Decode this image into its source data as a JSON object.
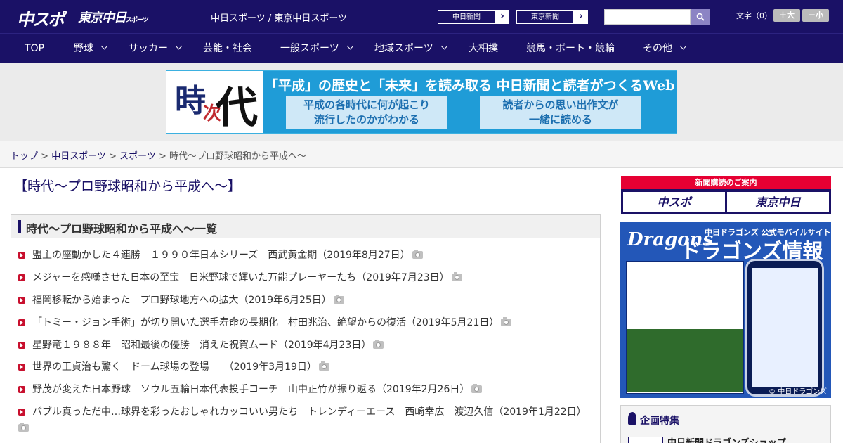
{
  "header": {
    "logo_chuspo": "中スポ",
    "logo_tokyo": "東京中日",
    "logo_tokyo_sub": "スポーツ",
    "site_title": "中日スポーツ / 東京中日スポーツ",
    "paper_links": [
      {
        "label": "中日新聞"
      },
      {
        "label": "東京新聞"
      }
    ],
    "search": {
      "placeholder": "",
      "icon": "search-icon"
    },
    "font_size": {
      "label": "文字（0）",
      "plus": "＋大",
      "minus": "－小"
    }
  },
  "nav": {
    "items": [
      {
        "label": "TOP",
        "dropdown": false
      },
      {
        "label": "野球",
        "dropdown": true
      },
      {
        "label": "サッカー",
        "dropdown": true
      },
      {
        "label": "芸能・社会",
        "dropdown": false
      },
      {
        "label": "一般スポーツ",
        "dropdown": true
      },
      {
        "label": "地域スポーツ",
        "dropdown": true
      },
      {
        "label": "大相撲",
        "dropdown": false
      },
      {
        "label": "競馬・ボート・競輪",
        "dropdown": false
      },
      {
        "label": "その他",
        "dropdown": true
      }
    ]
  },
  "banner": {
    "kanji_1": "時",
    "kanji_2": "次",
    "kanji_3": "代",
    "headline": "「平成」の歴史と「未来」を読み取る 中日新聞と読者がつくるWebサイト",
    "box_left_line1": "平成の各時代に何が起こり",
    "box_left_line2": "流行したのかがわかる",
    "box_right_line1": "読者からの思い出作文が",
    "box_right_line2": "一緒に読める"
  },
  "breadcrumb": {
    "items": [
      {
        "label": "トップ",
        "link": true
      },
      {
        "label": "中日スポーツ",
        "link": true
      },
      {
        "label": "スポーツ",
        "link": true
      },
      {
        "label": "時代～プロ野球昭和から平成へ～",
        "link": false
      }
    ],
    "separator": " > "
  },
  "main": {
    "page_title": "【時代～プロ野球昭和から平成へ～】",
    "list_title": "時代～プロ野球昭和から平成へ～一覧",
    "articles": [
      {
        "text": "盟主の座動かした４連勝　１９９０年日本シリーズ　西武黄金期（2019年8月27日）"
      },
      {
        "text": "メジャーを感嘆させた日本の至宝　日米野球で輝いた万能プレーヤーたち（2019年7月23日）"
      },
      {
        "text": "福岡移転から始まった　プロ野球地方への拡大（2019年6月25日）"
      },
      {
        "text": "「トミー・ジョン手術」が切り開いた選手寿命の長期化　村田兆治、絶望からの復活（2019年5月21日）"
      },
      {
        "text": "星野竜１９８８年　昭和最後の優勝　消えた祝賀ムード（2019年4月23日）"
      },
      {
        "text": "世界の王貞治も驚く　ドーム球場の登場　　（2019年3月19日）"
      },
      {
        "text": "野茂が変えた日本野球　ソウル五輪日本代表投手コーチ　山中正竹が振り返る（2019年2月26日）"
      },
      {
        "text": "バブル真っただ中…球界を彩ったおしゃれカッコいい男たち　トレンディーエース　西崎幸広　渡辺久信（2019年1月22日）"
      }
    ]
  },
  "sidebar": {
    "subscription": {
      "title": "新聞購読のご案内",
      "logo_left": "中スポ",
      "logo_right": "東京中日"
    },
    "dragons_ad": {
      "logo": "Dragons",
      "subtitle": "中日ドラゴンズ 公式モバイルサイト",
      "big_title": "ドラゴンズ情報",
      "footer": "© 中日ドラゴンズ"
    },
    "feature": {
      "title": "企画特集",
      "first_item": "中日新聞ドラゴンズショップ"
    }
  },
  "colors": {
    "brand_navy": "#1a1166",
    "accent_red": "#e60033",
    "banner_blue": "#1f9cd7",
    "dragons_blue": "#2357b8"
  }
}
